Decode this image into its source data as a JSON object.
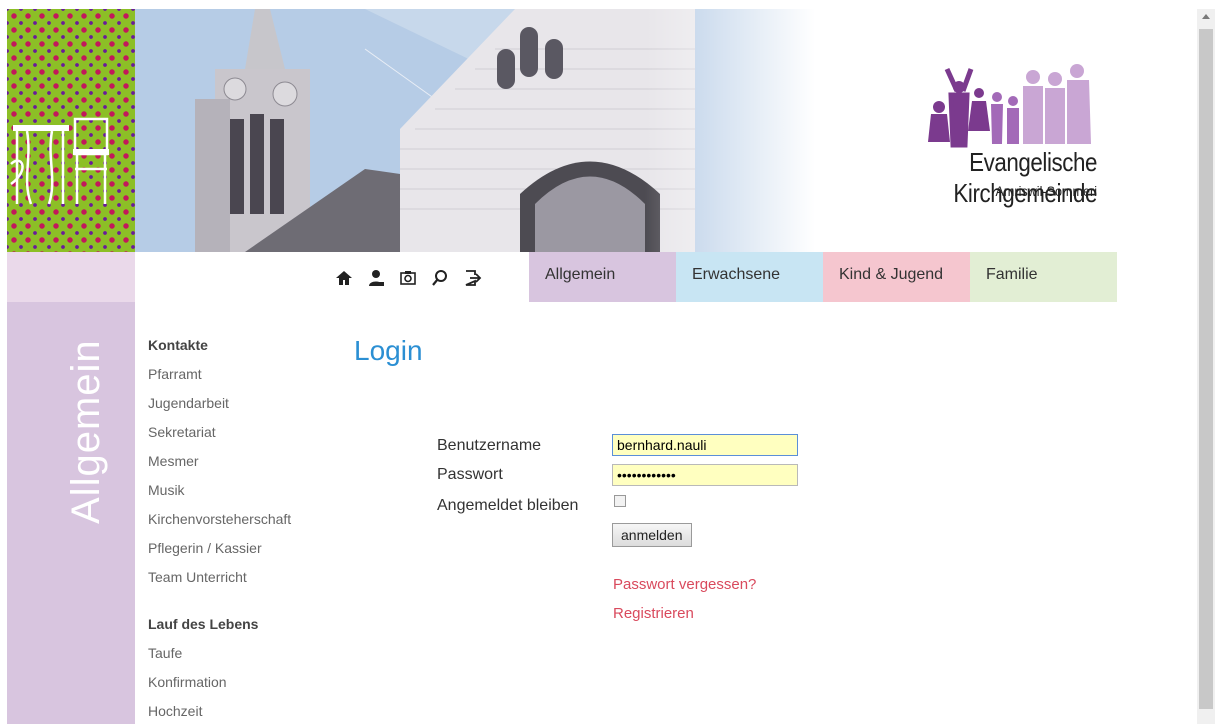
{
  "header": {
    "logo_title": "Evangelische Kirchgemeinde",
    "logo_subtitle": "Amriswil-Sommeri"
  },
  "nav": {
    "icons": [
      "home-icon",
      "user-icon",
      "camera-icon",
      "search-icon",
      "logout-icon"
    ],
    "tabs": [
      {
        "label": "Allgemein",
        "color": "#d8c5df"
      },
      {
        "label": "Erwachsene",
        "color": "#c8e5f3"
      },
      {
        "label": "Kind & Jugend",
        "color": "#f5c6cf"
      },
      {
        "label": "Familie",
        "color": "#e2eed4"
      }
    ]
  },
  "side_label": "Allgemein",
  "menu": {
    "sections": [
      {
        "title": "Kontakte",
        "items": [
          "Pfarramt",
          "Jugendarbeit",
          "Sekretariat",
          "Mesmer",
          "Musik",
          "Kirchenvorsteherschaft",
          "Pflegerin / Kassier",
          "Team Unterricht"
        ]
      },
      {
        "title": "Lauf des Lebens",
        "items": [
          "Taufe",
          "Konfirmation",
          "Hochzeit"
        ]
      }
    ]
  },
  "login": {
    "title": "Login",
    "username_label": "Benutzername",
    "username_value": "bernhard.nauli",
    "password_label": "Passwort",
    "password_value": "••••••••••••",
    "remember_label": "Angemeldet bleiben",
    "remember_checked": false,
    "submit_label": "anmelden",
    "forgot_link": "Passwort vergessen?",
    "register_link": "Registrieren"
  },
  "colors": {
    "accent_blue": "#2b8fd3",
    "link_red": "#d94a5d",
    "purple": "#d8c5df"
  }
}
